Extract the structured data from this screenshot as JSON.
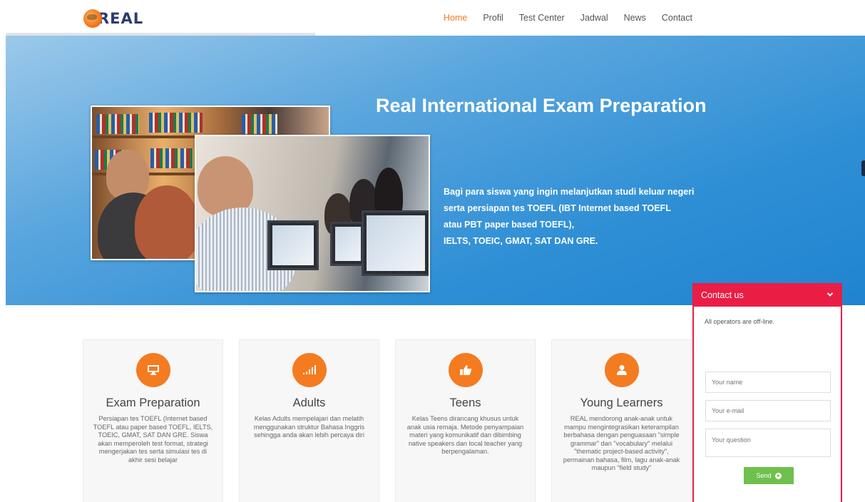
{
  "brand": {
    "logo_text": "REAL"
  },
  "nav": {
    "items": [
      {
        "label": "Home",
        "active": true
      },
      {
        "label": "Profil"
      },
      {
        "label": "Test Center"
      },
      {
        "label": "Jadwal"
      },
      {
        "label": "News"
      },
      {
        "label": "Contact"
      }
    ]
  },
  "hero": {
    "title": "Real International Exam Preparation",
    "text_lines": [
      "Bagi para siswa yang ingin melanjutkan studi keluar negeri",
      "serta persiapan tes TOEFL (IBT Internet based TOEFL",
      "atau PBT paper based TOEFL),",
      "IELTS, TOEIC, GMAT, SAT DAN GRE."
    ]
  },
  "cards": [
    {
      "icon": "monitor-icon",
      "title": "Exam Preparation",
      "text": "Persiapan tes TOEFL (Internet based TOEFL atau paper based TOEFL, IELTS, TOEIC, GMAT, SAT DAN GRE. Siswa akan memperoleh test format, strategi mengerjakan tes serta simulasi tes di akhir sesi belajar"
    },
    {
      "icon": "signal-bars-icon",
      "title": "Adults",
      "text": "Kelas Adults mempelajari dan melatih menggunakan struktur Bahasa Inggris sehingga anda akan lebih percaya diri"
    },
    {
      "icon": "thumbs-up-icon",
      "title": "Teens",
      "text": "Kelas Teens dirancang khusus untuk anak usia remaja. Metode penyampaian materi yang komunikatif dan dibimbing native speakers dan local teacher yang berpengalaman."
    },
    {
      "icon": "user-icon",
      "title": "Young Learners",
      "text": "REAL mendorong anak-anak untuk mampu mengintegrasikan keterampilan berbahasa dengan penguasaan \"simple grammar\" dan \"vocabulary\" melalui \"thematic project-based activity\", permainan bahasa, film, lagu anak-anak maupun \"field study\""
    }
  ],
  "contact": {
    "header": "Contact us",
    "status": "All operators are off-line.",
    "name_placeholder": "Your name",
    "email_placeholder": "Your e-mail",
    "question_placeholder": "Your question",
    "send_label": "Send"
  },
  "colors": {
    "accent": "#f47b20",
    "hero_blue": "#2f8fd5",
    "contact_red": "#ea1d45",
    "send_green": "#6fc04c"
  }
}
